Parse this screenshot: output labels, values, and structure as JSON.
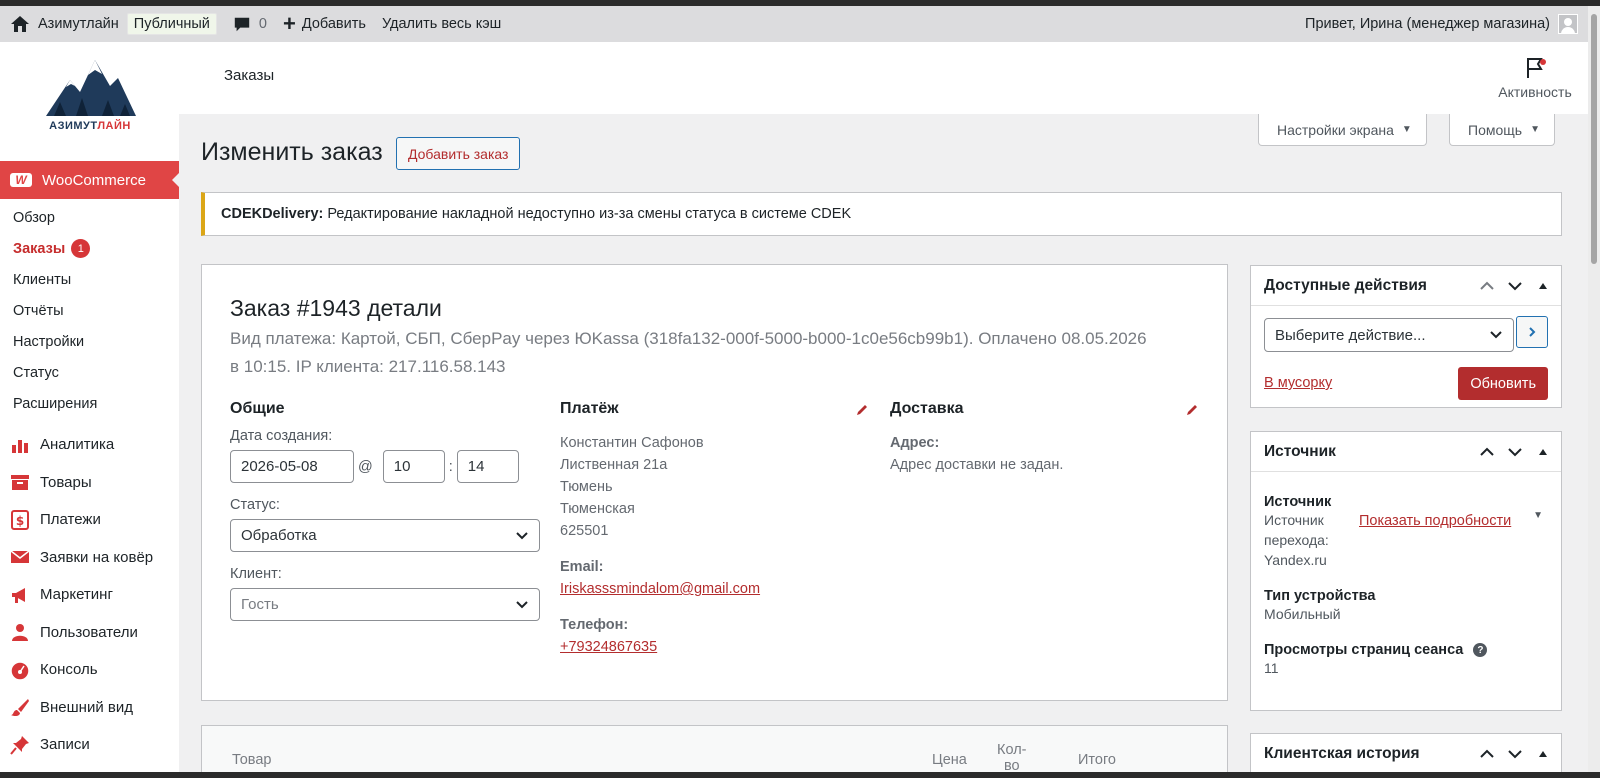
{
  "adminbar": {
    "site_name": "Азимутлайн",
    "visibility": "Публичный",
    "comments_count": "0",
    "add_new": "Добавить",
    "purge_cache": "Удалить весь кэш",
    "greeting": "Привет, Ирина (менеджер магазина)"
  },
  "logo": {
    "text_dark": "АЗИМУТ",
    "text_red": "ЛАЙН"
  },
  "sidebar": {
    "woocommerce": "WooCommerce",
    "submenu": [
      "Обзор",
      "Заказы",
      "Клиенты",
      "Отчёты",
      "Настройки",
      "Статус",
      "Расширения"
    ],
    "orders_badge": "1",
    "menu": [
      "Аналитика",
      "Товары",
      "Платежи",
      "Заявки на ковёр",
      "Маркетинг",
      "Пользователи",
      "Консоль",
      "Внешний вид",
      "Записи"
    ]
  },
  "header": {
    "title": "Заказы",
    "activity": "Активность",
    "screen_options": "Настройки экрана",
    "help": "Помощь"
  },
  "page": {
    "title": "Изменить заказ",
    "add_order": "Добавить заказ"
  },
  "notice": {
    "source": "CDEKDelivery:",
    "message": "Редактирование накладной недоступно из-за смены статуса в системе CDEK"
  },
  "order": {
    "heading": "Заказ #1943 детали",
    "meta_line1": "Вид платежа: Картой, СБП, СберPay через ЮKassa (318fa132-000f-5000-b000-1c0e56cb99b1). Оплачено 08.05.2026",
    "meta_line2": "в 10:15. IP клиента: 217.116.58.143",
    "general": {
      "title": "Общие",
      "date_label": "Дата создания:",
      "date": "2026-05-08",
      "at": "@",
      "hour": "10",
      "colon": ":",
      "minute": "14",
      "status_label": "Статус:",
      "status": "Обработка",
      "customer_label": "Клиент:",
      "customer": "Гость"
    },
    "billing": {
      "title": "Платёж",
      "lines": [
        "Константин Сафонов",
        "Лиственная 21а",
        "Тюмень",
        "Тюменская",
        "625501"
      ],
      "email_label": "Email:",
      "email": "Iriskasssmindalom@gmail.com",
      "phone_label": "Телефон:",
      "phone": "+79324867635"
    },
    "shipping": {
      "title": "Доставка",
      "address_label": "Адрес:",
      "address": "Адрес доставки не задан."
    }
  },
  "items": {
    "columns": {
      "product": "Товар",
      "price": "Цена",
      "qty_1": "Кол-",
      "qty_2": "во",
      "total": "Итого"
    }
  },
  "actions_box": {
    "title": "Доступные действия",
    "select": "Выберите действие...",
    "trash": "В мусорку",
    "update": "Обновить"
  },
  "source_box": {
    "title": "Источник",
    "source_label": "Источник",
    "referral_label_1": "Источник",
    "referral_label_2": "перехода:",
    "referral_value": "Yandex.ru",
    "details_link": "Показать подробности",
    "device_label": "Тип устройства",
    "device_value": "Мобильный",
    "pageviews_label": "Просмотры страниц сеанса",
    "pageviews_value": "11"
  },
  "history_box": {
    "title": "Клиентская история"
  },
  "colors": {
    "accent": "#d63638",
    "link": "#b32d2e",
    "woo": "#e04545",
    "notice_border": "#dba617"
  }
}
